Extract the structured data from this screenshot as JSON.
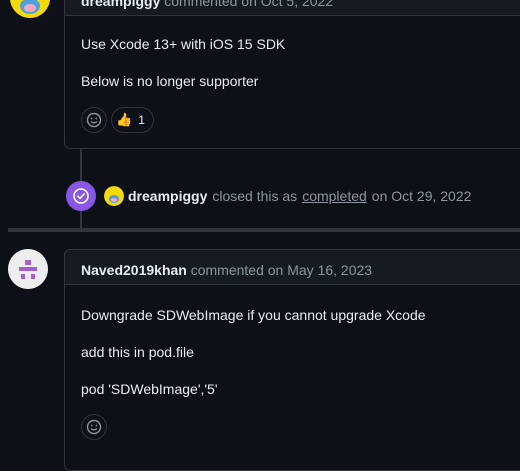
{
  "comment1": {
    "author": "dreampiggy",
    "action": "commented on",
    "date": "Oct 5, 2022",
    "lines": [
      "Use Xcode 13+ with iOS 15 SDK",
      "Below is no longer supporter"
    ],
    "reaction": {
      "emoji": "👍",
      "count": "1"
    }
  },
  "event": {
    "author": "dreampiggy",
    "text_before": "closed this as",
    "link_text": "completed",
    "text_after": "on Oct 29, 2022"
  },
  "comment2": {
    "author": "Naved2019khan",
    "action": "commented on",
    "date": "May 16, 2023",
    "lines": [
      "Downgrade SDWebImage if you cannot upgrade Xcode",
      "add this in pod.file",
      "pod 'SDWebImage','5'"
    ]
  },
  "colors": {
    "background": "#0d1117",
    "header_bg": "#161b22",
    "border": "#30363d",
    "closed_purple": "#8957e5",
    "muted_text": "#8d96a0"
  },
  "icons": {
    "emoji_picker": "smiley-icon",
    "closed": "check-circle-icon"
  }
}
